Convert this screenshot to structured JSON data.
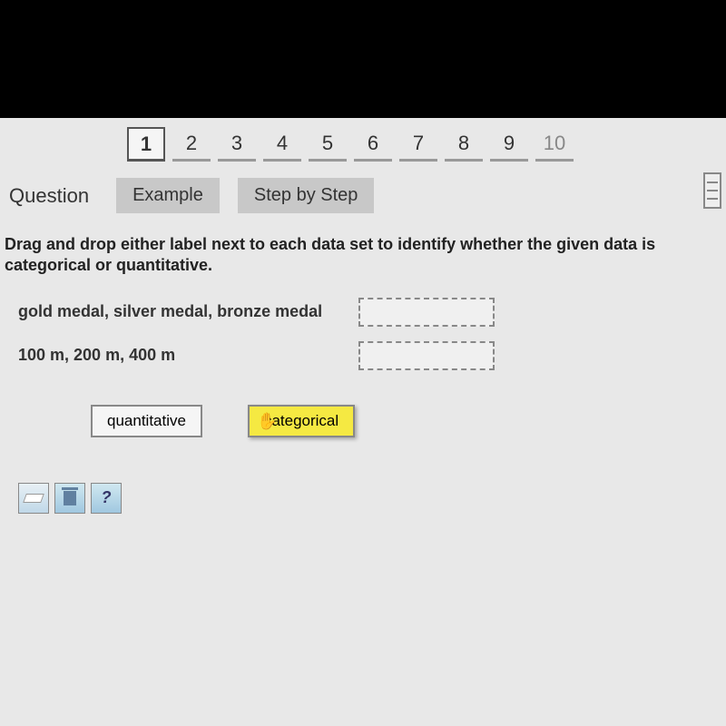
{
  "nav": {
    "questions": [
      "1",
      "2",
      "3",
      "4",
      "5",
      "6",
      "7",
      "8",
      "9",
      "10"
    ],
    "active_index": 0
  },
  "tabs": {
    "question_label": "Question",
    "example_label": "Example",
    "step_label": "Step by Step"
  },
  "instructions": "Drag and drop either label next to each data set to identify whether the given data is categorical or quantitative.",
  "data_sets": [
    {
      "label": "gold medal, silver medal, bronze medal"
    },
    {
      "label": "100 m, 200 m, 400 m"
    }
  ],
  "draggables": {
    "quantitative": "quantitative",
    "categorical": "categorical"
  },
  "toolbar": {
    "help": "?"
  }
}
